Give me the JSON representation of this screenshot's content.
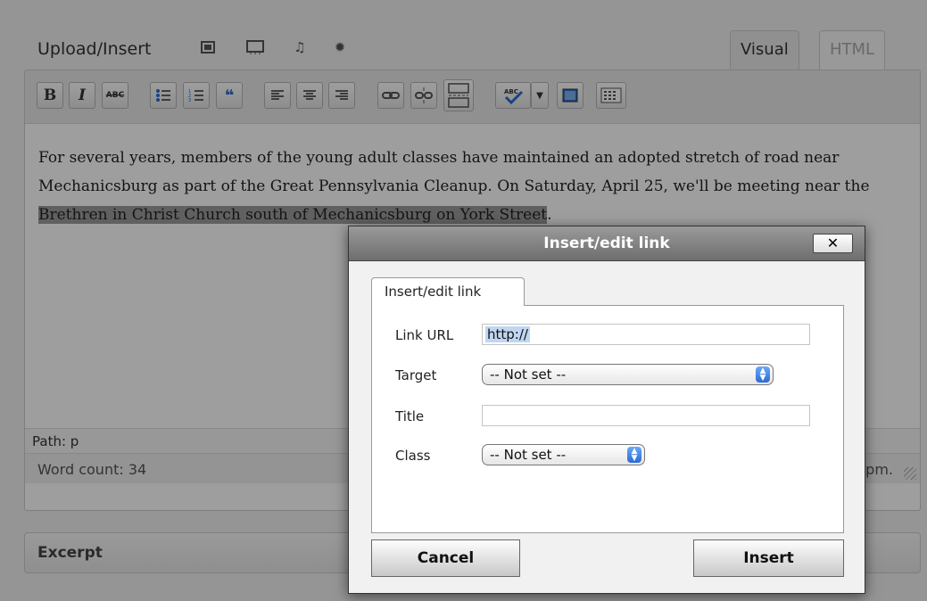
{
  "editor": {
    "upload_label": "Upload/Insert",
    "media_icons": [
      "image-icon",
      "video-icon",
      "audio-icon",
      "media-icon"
    ],
    "tabs": {
      "visual": "Visual",
      "html": "HTML"
    },
    "toolbar": {
      "bold": "B",
      "italic": "I",
      "strike": "ABC",
      "buttons": [
        "bold-button",
        "italic-button",
        "strikethrough-button",
        "bulleted-list-button",
        "numbered-list-button",
        "blockquote-button",
        "align-left-button",
        "align-center-button",
        "align-right-button",
        "insert-link-button",
        "unlink-button",
        "insert-more-button",
        "spellcheck-button",
        "spellcheck-dropdown",
        "fullscreen-button",
        "kitchen-sink-button"
      ]
    },
    "content": {
      "text_before": "For several years, members of the young adult classes have maintained an adopted stretch of road near Mechanicsburg as part of the Great Pennsylvania Cleanup. On Saturday, April 25, we'll be meeting near the ",
      "selected_text": "Brethren in Christ Church south of Mechanicsburg on York Street",
      "text_after": "."
    },
    "path": "Path: p",
    "word_count": "Word count: 34",
    "status_right_visible": "pm.",
    "excerpt_label": "Excerpt"
  },
  "dialog": {
    "title": "Insert/edit link",
    "close_label": "✕",
    "tab_label": "Insert/edit link",
    "fields": {
      "link_url": {
        "label": "Link URL",
        "value": "http://"
      },
      "target": {
        "label": "Target",
        "value": "-- Not set --"
      },
      "title": {
        "label": "Title",
        "value": ""
      },
      "class": {
        "label": "Class",
        "value": "-- Not set --"
      }
    },
    "cancel_label": "Cancel",
    "insert_label": "Insert"
  },
  "colors": {
    "selection_highlight": "#9c9c9c",
    "url_selection": "#c0d6f2",
    "select_arrow": "#2b6bd6"
  }
}
